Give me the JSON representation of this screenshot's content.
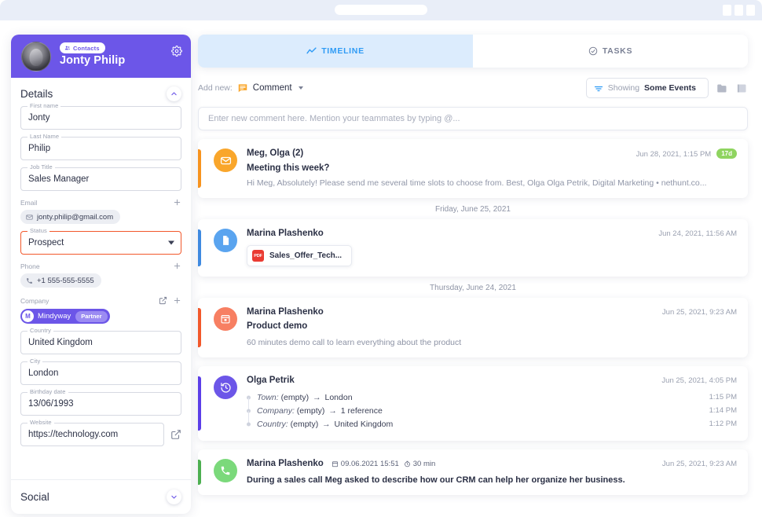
{
  "browser": {
    "window_buttons": [
      "minimize",
      "maximize",
      "close"
    ]
  },
  "sidebar": {
    "record_type": "Contacts",
    "contact_name": "Jonty Philip",
    "gear_title": "Settings",
    "details": {
      "section_title": "Details",
      "collapse_label": "collapse",
      "fields": [
        {
          "label": "First name",
          "value": "Jonty"
        },
        {
          "label": "Last Name",
          "value": "Philip"
        },
        {
          "label": "Job Title",
          "value": "Sales Manager"
        }
      ],
      "email": {
        "label": "Email",
        "value": "jonty.philip@gmail.com",
        "add_label": "+"
      },
      "status": {
        "label": "Status",
        "value": "Prospect",
        "focus_color": "#f2582b"
      },
      "phone": {
        "label": "Phone",
        "value": "+1 555-555-5555",
        "add_label": "+"
      },
      "company": {
        "label": "Company",
        "initial": "M",
        "name": "Mindyway",
        "tag": "Partner"
      },
      "country": {
        "label": "Country",
        "value": "United Kingdom"
      },
      "city": {
        "label": "City",
        "value": "London"
      },
      "birthday": {
        "label": "Birthday date",
        "value": "13/06/1993"
      },
      "website": {
        "label": "Website",
        "value": "https://technology.com"
      }
    },
    "social": {
      "section_title": "Social",
      "expand_label": "expand"
    }
  },
  "main": {
    "tabs": [
      {
        "label": "TIMELINE",
        "icon": "trendline-icon",
        "active": true
      },
      {
        "label": "TASKS",
        "icon": "check-circle-icon",
        "active": false
      }
    ],
    "toolbar": {
      "add_new_label": "Add new:",
      "add_new_value": "Comment",
      "filter_prefix": "Showing",
      "filter_value": "Some Events",
      "folder_icon": "folder-icon",
      "archive_icon": "archive-icon"
    },
    "composer": {
      "placeholder": "Enter new comment here. Mention your teammates by typing @..."
    },
    "timeline": [
      {
        "kind": "email",
        "accent": "#f7931e",
        "avatar_color": "#f9a62b",
        "icon": "envelope-icon",
        "who": "Meg, Olga (2)",
        "when": "Jun 28, 2021, 1:15 PM",
        "badge": "17d",
        "subject": "Meeting this week?",
        "snippet": "Hi Meg, Absolutely! Please send me several time slots to choose from. Best, Olga Olga Petrik, Digital Marketing • nethunt.co..."
      },
      {
        "kind": "day-separator",
        "label": "Friday, June 25, 2021"
      },
      {
        "kind": "file",
        "accent": "#3f8ae0",
        "avatar_color": "#5aa4ef",
        "icon": "document-icon",
        "who": "Marina Plashenko",
        "when": "Jun 24, 2021, 11:56 AM",
        "attachment": {
          "type": "PDF",
          "name": "Sales_Offer_Tech..."
        }
      },
      {
        "kind": "day-separator",
        "label": "Thursday, June 24, 2021"
      },
      {
        "kind": "event",
        "accent": "#f2582b",
        "avatar_color": "#f77f62",
        "icon": "calendar-icon",
        "who": "Marina Plashenko",
        "when": "Jun 25, 2021, 9:23 AM",
        "subject": "Product demo",
        "description": "60 minutes demo call to learn everything about the product"
      },
      {
        "kind": "changelog",
        "accent": "#5b3ee8",
        "avatar_color": "#6c56e8",
        "icon": "history-icon",
        "who": "Olga Petrik",
        "when": "Jun 25, 2021, 4:05 PM",
        "changes": [
          {
            "field": "Town",
            "from": "(empty)",
            "to": "London",
            "time": "1:15 PM"
          },
          {
            "field": "Company",
            "from": "(empty)",
            "to": "1 reference",
            "time": "1:14 PM"
          },
          {
            "field": "Country",
            "from": "(empty)",
            "to": "United Kingdom",
            "time": "1:12 PM"
          }
        ]
      },
      {
        "kind": "call",
        "accent": "#4caf50",
        "avatar_color": "#7bd97b",
        "icon": "phone-icon",
        "who": "Marina Plashenko",
        "when": "Jun 25, 2021, 9:23 AM",
        "call_date": "09.06.2021 15:51",
        "call_duration": "30 min",
        "note": "During a sales call Meg asked to describe how our CRM can help her organize her business."
      }
    ]
  }
}
